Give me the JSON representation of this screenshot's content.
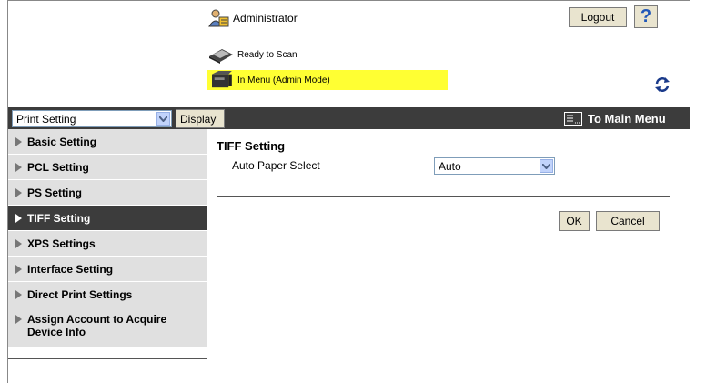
{
  "header": {
    "user_label": "Administrator",
    "logout_label": "Logout",
    "help_label": "?",
    "status_ready": "Ready to Scan",
    "status_menu": "In Menu (Admin Mode)",
    "status_highlight_color": "#ffff33"
  },
  "menubar": {
    "category_value": "Print Setting",
    "display_label": "Display",
    "main_menu_label": "To Main Menu",
    "bar_color": "#3c3c3c"
  },
  "sidebar": {
    "items": [
      {
        "label": "Basic Setting",
        "active": false
      },
      {
        "label": "PCL Setting",
        "active": false
      },
      {
        "label": "PS Setting",
        "active": false
      },
      {
        "label": "TIFF Setting",
        "active": true
      },
      {
        "label": "XPS Settings",
        "active": false
      },
      {
        "label": "Interface Setting",
        "active": false
      },
      {
        "label": "Direct Print Settings",
        "active": false
      },
      {
        "label": "Assign Account to Acquire Device Info",
        "active": false
      }
    ]
  },
  "main": {
    "title": "TIFF Setting",
    "field_label": "Auto Paper Select",
    "field_value": "Auto",
    "ok_label": "OK",
    "cancel_label": "Cancel"
  }
}
